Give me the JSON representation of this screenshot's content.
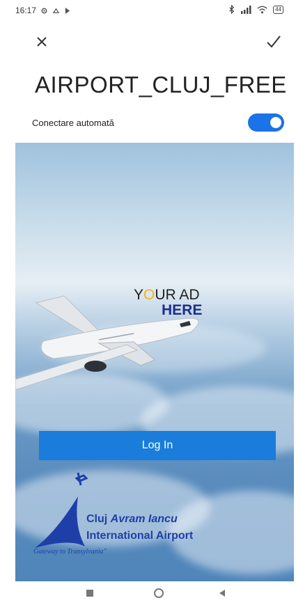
{
  "status_bar": {
    "time": "16:17",
    "battery": "44"
  },
  "header": {
    "close_icon": "close-icon",
    "confirm_icon": "check-icon"
  },
  "network": {
    "name": "AIRPORT_CLUJ_FREE"
  },
  "auto_connect": {
    "label": "Conectare automată",
    "enabled": true
  },
  "portal": {
    "ad_line1_prefix": "Y",
    "ad_line1_o": "O",
    "ad_line1_rest": "UR AD",
    "ad_line2": "HERE",
    "login_label": "Log In",
    "logo_line1_plain": "Cluj ",
    "logo_line1_italic": "Avram Iancu",
    "logo_line2": "International Airport",
    "logo_tagline": "Gateway to Transylvania\""
  },
  "colors": {
    "accent": "#1a73e8",
    "login_button": "#1a7ddb",
    "logo_blue": "#1f3fa8"
  }
}
